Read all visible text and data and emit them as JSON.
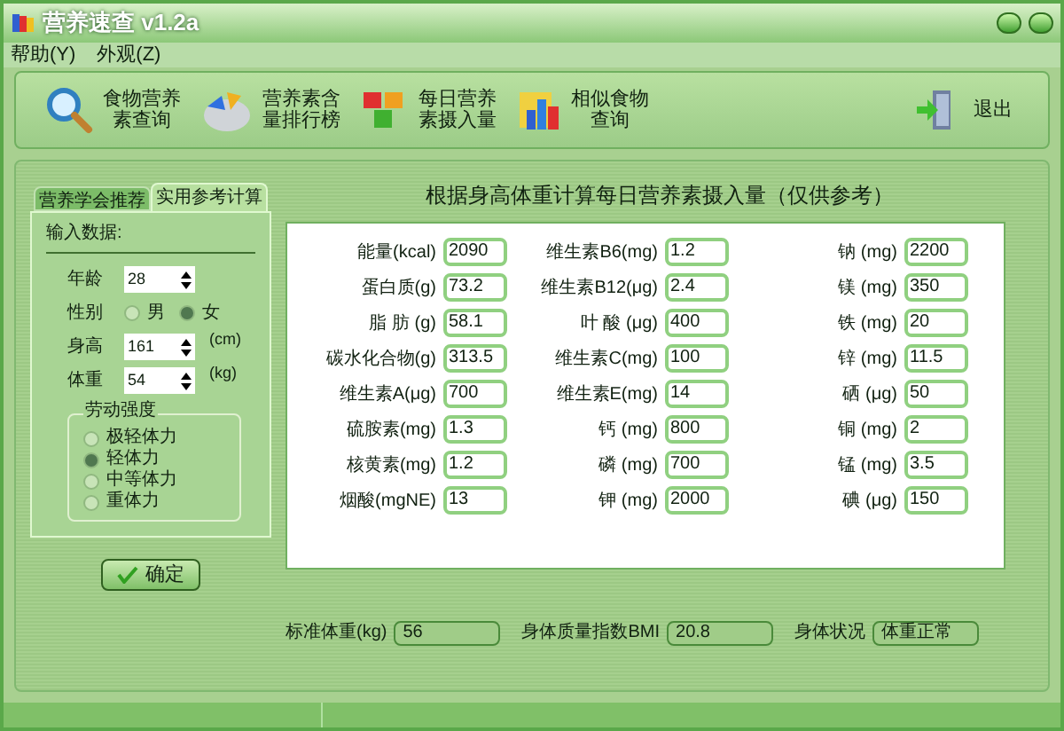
{
  "window": {
    "title": "营养速查 v1.2a"
  },
  "menu": [
    "帮助(Y)",
    "外观(Z)"
  ],
  "toolbar": [
    {
      "kind": "search",
      "label": "食物营养素查询"
    },
    {
      "kind": "pie",
      "label": "营养素含量排行榜"
    },
    {
      "kind": "cubes",
      "label": "每日营养素摄入量"
    },
    {
      "kind": "chart",
      "label": "相似食物查询"
    }
  ],
  "exit_button": {
    "label": "退出"
  },
  "tabs": [
    {
      "label": "营养学会推荐",
      "selected": false
    },
    {
      "label": "实用参考计算",
      "selected": true
    }
  ],
  "form": {
    "heading": "输入数据:",
    "age": {
      "label": "年龄",
      "value": "28"
    },
    "gender": {
      "label": "性别",
      "options": [
        {
          "label": "男",
          "selected": false
        },
        {
          "label": "女",
          "selected": true
        }
      ]
    },
    "height": {
      "label": "身高",
      "value": "161",
      "unit": "(cm)"
    },
    "weight": {
      "label": "体重",
      "value": "54",
      "unit": "(kg)"
    },
    "labor": {
      "title": "劳动强度",
      "options": [
        {
          "label": "极轻体力",
          "selected": false
        },
        {
          "label": "轻体力",
          "selected": true
        },
        {
          "label": "中等体力",
          "selected": false
        },
        {
          "label": "重体力",
          "selected": false
        }
      ]
    },
    "confirm": "确定"
  },
  "results_title": "根据身高体重计算每日营养素摄入量（仅供参考）",
  "nutrients": [
    {
      "label": "能量(kcal)",
      "value": "2090"
    },
    {
      "label": "维生素B6(mg)",
      "value": "1.2"
    },
    {
      "label": "钠 (mg)",
      "value": "2200"
    },
    {
      "label": "蛋白质(g)",
      "value": "73.2"
    },
    {
      "label": "维生素B12(μg)",
      "value": "2.4"
    },
    {
      "label": "镁 (mg)",
      "value": "350"
    },
    {
      "label": "脂 肪 (g)",
      "value": "58.1"
    },
    {
      "label": "叶 酸 (μg)",
      "value": "400"
    },
    {
      "label": "铁 (mg)",
      "value": "20"
    },
    {
      "label": "碳水化合物(g)",
      "value": "313.5"
    },
    {
      "label": "维生素C(mg)",
      "value": "100"
    },
    {
      "label": "锌 (mg)",
      "value": "11.5"
    },
    {
      "label": "维生素A(μg)",
      "value": "700"
    },
    {
      "label": "维生素E(mg)",
      "value": "14"
    },
    {
      "label": "硒 (μg)",
      "value": "50"
    },
    {
      "label": "硫胺素(mg)",
      "value": "1.3"
    },
    {
      "label": "钙 (mg)",
      "value": "800"
    },
    {
      "label": "铜 (mg)",
      "value": "2"
    },
    {
      "label": "核黄素(mg)",
      "value": "1.2"
    },
    {
      "label": "磷 (mg)",
      "value": "700"
    },
    {
      "label": "锰 (mg)",
      "value": "3.5"
    },
    {
      "label": "烟酸(mgNE)",
      "value": "13"
    },
    {
      "label": "钾 (mg)",
      "value": "2000"
    },
    {
      "label": "碘 (μg)",
      "value": "150"
    }
  ],
  "summary": [
    {
      "label": "标准体重(kg)",
      "value": "56"
    },
    {
      "label": "身体质量指数BMI",
      "value": "20.8"
    },
    {
      "label": "身体状况",
      "value": "体重正常"
    }
  ]
}
